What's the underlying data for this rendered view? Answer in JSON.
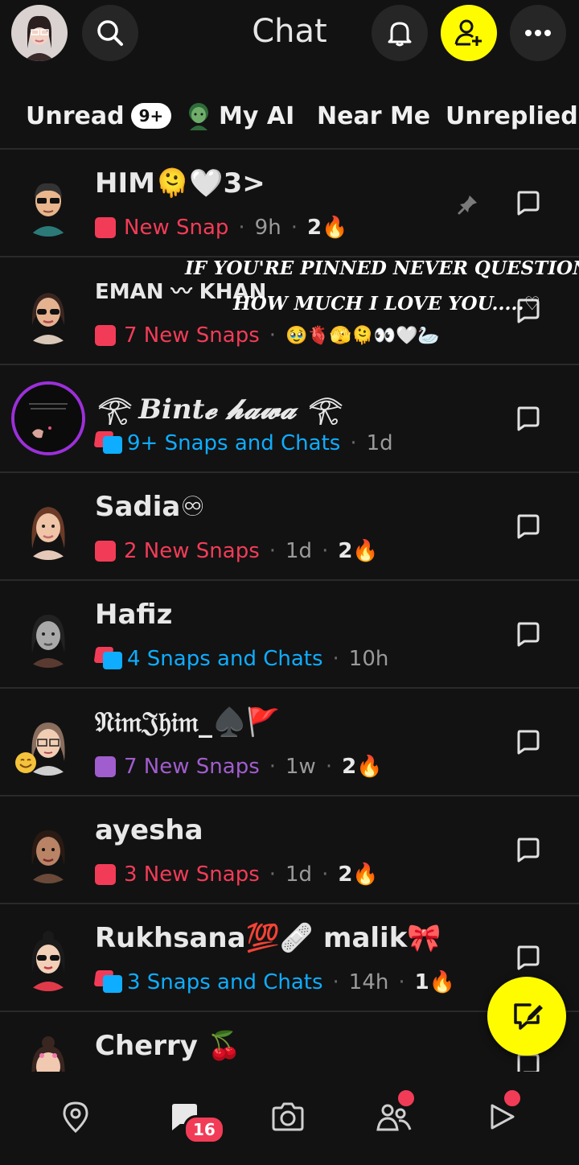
{
  "header": {
    "title": "Chat",
    "icons": [
      "profile-avatar",
      "search-icon",
      "bell-icon",
      "add-friend-icon",
      "more-icon"
    ]
  },
  "tabs": [
    {
      "label": "Unread",
      "badge": "9+"
    },
    {
      "label": "My AI"
    },
    {
      "label": "Near Me"
    },
    {
      "label": "Unreplied"
    }
  ],
  "chats": [
    {
      "name": "HIM🫠🤍3>",
      "status_icon": "red-square",
      "status": "New Snap",
      "time": "9h",
      "streak": "2🔥",
      "pinned": true
    },
    {
      "name": "EMAN 〰 KHAN",
      "status_icon": "red-square",
      "status": "7 New Snaps",
      "emojis": "🥹🫀🫣🫠👀🤍🦢",
      "overlay": {
        "line1": "IF YOU'RE PINNED NEVER QUESTION",
        "line2": "HOW MUCH I LOVE YOU.....♡"
      }
    },
    {
      "name": "𓂀 Bint𝓮 𝓱𝓪𝔀𝓪 𓂀",
      "status_icon": "chat-bubbles",
      "status": "9+ Snaps and Chats",
      "time": "1d"
    },
    {
      "name": "Sadia♾",
      "status_icon": "red-square",
      "status": "2 New Snaps",
      "time": "1d",
      "streak": "2🔥"
    },
    {
      "name": "Hafiz",
      "status_icon": "chat-bubbles",
      "status": "4 Snaps and Chats",
      "time": "10h"
    },
    {
      "name": "𝔑𝔦𝔪𝔍𝔥𝔦𝔪_♠️🚩",
      "status_icon": "purple-square",
      "status": "7 New Snaps",
      "time": "1w",
      "streak": "2🔥"
    },
    {
      "name": "ayesha",
      "status_icon": "red-square",
      "status": "3 New Snaps",
      "time": "1d",
      "streak": "2🔥"
    },
    {
      "name": "Rukhsana💯🩹 malik🎀",
      "status_icon": "chat-bubbles",
      "status": "3 Snaps and Chats",
      "time": "14h",
      "streak": "1🔥"
    },
    {
      "name": "Cherry 🍒"
    }
  ],
  "bottom_nav": {
    "items": [
      "map-icon",
      "chat-icon",
      "camera-icon",
      "friends-icon",
      "stories-icon"
    ],
    "chat_badge": "16"
  },
  "colors": {
    "background": "#121212",
    "accent_yellow": "#FFFC00",
    "snap_red": "#F23C57",
    "chat_blue": "#0EADFF",
    "video_purple": "#A05DCD"
  }
}
